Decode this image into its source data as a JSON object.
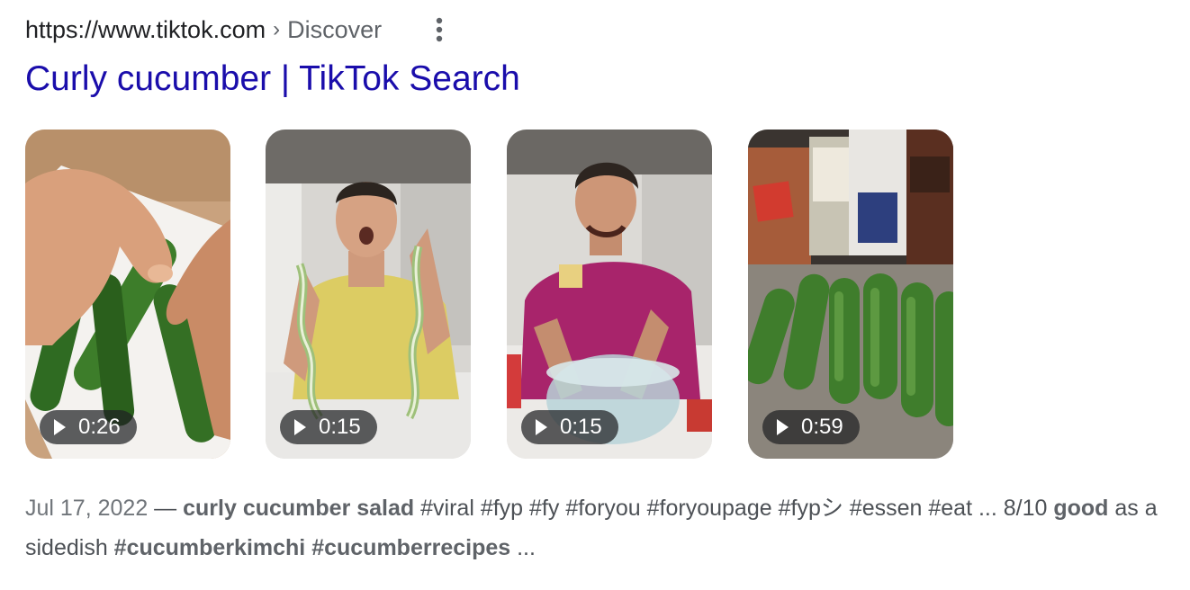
{
  "result": {
    "url_domain": "https://www.tiktok.com",
    "url_separator": "›",
    "url_path": "Discover",
    "more_icon": "vertical-dots-icon",
    "title": "Curly cucumber | TikTok Search",
    "colors": {
      "title_link": "#1a0dab",
      "url_text": "#202124",
      "snippet_text": "#4d5156"
    }
  },
  "videos": [
    {
      "duration": "0:26",
      "icon": "play-icon"
    },
    {
      "duration": "0:15",
      "icon": "play-icon"
    },
    {
      "duration": "0:15",
      "icon": "play-icon"
    },
    {
      "duration": "0:59",
      "icon": "play-icon"
    }
  ],
  "snippet": {
    "date": "Jul 17, 2022",
    "dash": " — ",
    "bold1": "curly cucumber salad",
    "text1": " #viral #fyp #fy #foryou #foryoupage #fypシ #essen #eat ... 8/10 ",
    "bold2": "good",
    "text2": " as a sidedish ",
    "bold3": "#cucumberkimchi #cucumberrecipes",
    "text3": " ..."
  }
}
